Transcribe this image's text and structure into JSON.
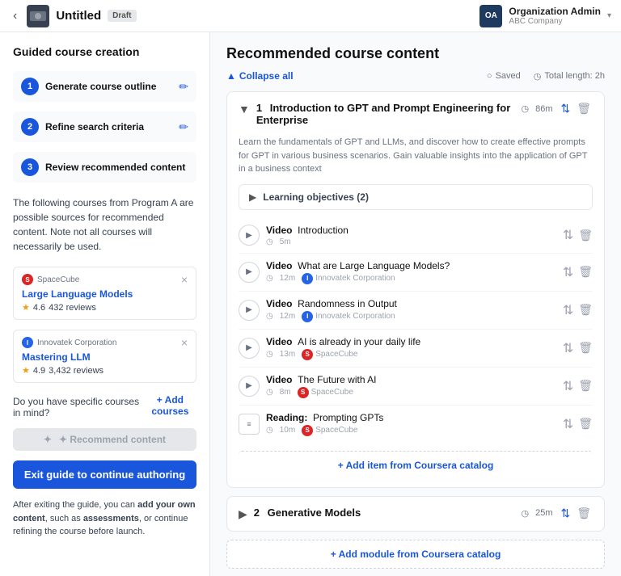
{
  "topbar": {
    "back_label": "‹",
    "course_title": "Untitled",
    "draft_badge": "Draft",
    "org_initials": "OA",
    "org_name": "Organization Admin",
    "org_sub": "ABC Company",
    "chevron": "▾"
  },
  "sidebar": {
    "title": "Guided course creation",
    "steps": [
      {
        "num": "1",
        "label": "Generate course outline"
      },
      {
        "num": "2",
        "label": "Refine search criteria"
      },
      {
        "num": "3",
        "label": "Review recommended content"
      }
    ],
    "step3_desc": "The following courses from Program A are possible sources for recommended content. Note not all courses will necessarily be used.",
    "courses": [
      {
        "provider": "SpaceCube",
        "provider_type": "spacecube",
        "name": "Large Language Models",
        "rating": "4.6",
        "reviews": "432 reviews"
      },
      {
        "provider": "Innovatek Corporation",
        "provider_type": "innovatek",
        "name": "Mastering LLM",
        "rating": "4.9",
        "reviews": "3,432 reviews"
      }
    ],
    "specific_q": "Do you have specific courses in mind?",
    "add_courses_label": "+ Add courses",
    "recommend_btn": "✦ Recommend content",
    "exit_btn": "Exit guide to continue authoring",
    "exit_note_pre": "After exiting the guide, you can ",
    "exit_note_bold": "add your own content",
    "exit_note_mid": ", such as ",
    "exit_note_bold2": "assessments",
    "exit_note_post": ", or continue refining the course before launch."
  },
  "content": {
    "title": "Recommended course content",
    "collapse_all": "Collapse all",
    "saved_label": "Saved",
    "total_length_label": "Total length: 2h",
    "module1": {
      "num": "1",
      "title": "Introduction to GPT and Prompt Engineering for Enterprise",
      "duration": "86m",
      "desc": "Learn the fundamentals of GPT and LLMs, and discover how to create effective prompts for GPT in various business scenarios. Gain valuable insights into the application of GPT in a business context",
      "objectives_label": "Learning objectives (2)",
      "items": [
        {
          "type": "Video",
          "title": "Introduction",
          "duration": "5m",
          "provider": "",
          "provider_type": ""
        },
        {
          "type": "Video",
          "title": "What are Large Language Models?",
          "duration": "12m",
          "provider": "Innovatek Corporation",
          "provider_type": "innovatek"
        },
        {
          "type": "Video",
          "title": "Randomness in Output",
          "duration": "12m",
          "provider": "Innovatek Corporation",
          "provider_type": "innovatek"
        },
        {
          "type": "Video",
          "title": "AI is already in your daily life",
          "duration": "13m",
          "provider": "SpaceCube",
          "provider_type": "spacecube"
        },
        {
          "type": "Video",
          "title": "The Future with AI",
          "duration": "8m",
          "provider": "SpaceCube",
          "provider_type": "spacecube"
        },
        {
          "type": "Reading",
          "title": "Prompting GPTs",
          "duration": "10m",
          "provider": "SpaceCube",
          "provider_type": "spacecube"
        }
      ],
      "add_item_label": "+ Add item from Coursera catalog"
    },
    "module2": {
      "num": "2",
      "title": "Generative Models",
      "duration": "25m"
    },
    "add_module_label": "+ Add module from Coursera catalog"
  }
}
